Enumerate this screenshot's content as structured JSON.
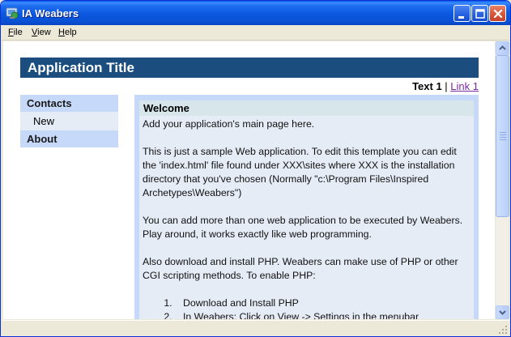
{
  "window": {
    "title": "IA Weabers"
  },
  "menu": {
    "items": [
      {
        "label": "File",
        "accel": "F",
        "rest": "ile"
      },
      {
        "label": "View",
        "accel": "V",
        "rest": "iew"
      },
      {
        "label": "Help",
        "accel": "H",
        "rest": "elp"
      }
    ]
  },
  "page": {
    "app_title": "Application Title",
    "tabs": {
      "active": "Text 1",
      "separator": " | ",
      "link": "Link 1"
    },
    "sidebar": {
      "contacts": "Contacts",
      "new": "New",
      "about": "About"
    },
    "welcome": {
      "heading": "Welcome",
      "intro": "Add your application's main page here.",
      "para1": "This is just a sample Web application. To edit this template you can edit the 'index.html' file found under XXX\\sites where XXX is the installation directory that you've chosen (Normally \"c:\\Program Files\\Inspired Archetypes\\Weabers\")",
      "para2": "You can add more than one web application to be executed by Weabers. Play around, it works exactly like web programming.",
      "para3": "Also download and install PHP. Weabers can make use of PHP or other CGI scripting methods. To enable PHP:",
      "steps": [
        "Download and Install PHP",
        "In Weabers: Click on View -> Settings in the menubar"
      ]
    }
  },
  "colors": {
    "header_bg": "#1b4e7f",
    "sidebar_head_bg": "#c6d9f9",
    "panel_bg": "#e5ecf6",
    "link": "#7b2aa6"
  }
}
